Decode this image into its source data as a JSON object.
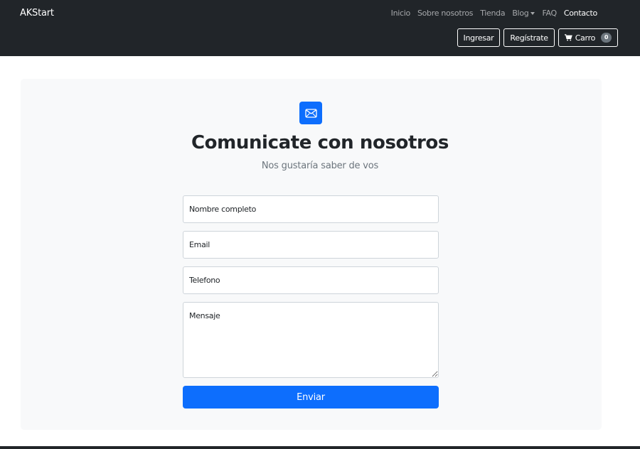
{
  "navbar": {
    "brand": "AKStart",
    "links": [
      "Inicio",
      "Sobre nosotros",
      "Tienda",
      "Blog",
      "FAQ",
      "Contacto"
    ],
    "login_label": "Ingresar",
    "register_label": "Regístrate",
    "cart_label": "Carro",
    "cart_count": "0"
  },
  "contact": {
    "icon": "envelope-icon",
    "title": "Comunicate con nosotros",
    "subtitle": "Nos gustaría saber de vos",
    "fields": {
      "name_placeholder": "Nombre completo",
      "email_placeholder": "Email",
      "phone_placeholder": "Telefono",
      "message_placeholder": "Mensaje"
    },
    "submit_label": "Enviar"
  },
  "colors": {
    "navbar_bg": "#212529",
    "primary": "#0d6efd",
    "panel_bg": "#f8f9fa"
  }
}
